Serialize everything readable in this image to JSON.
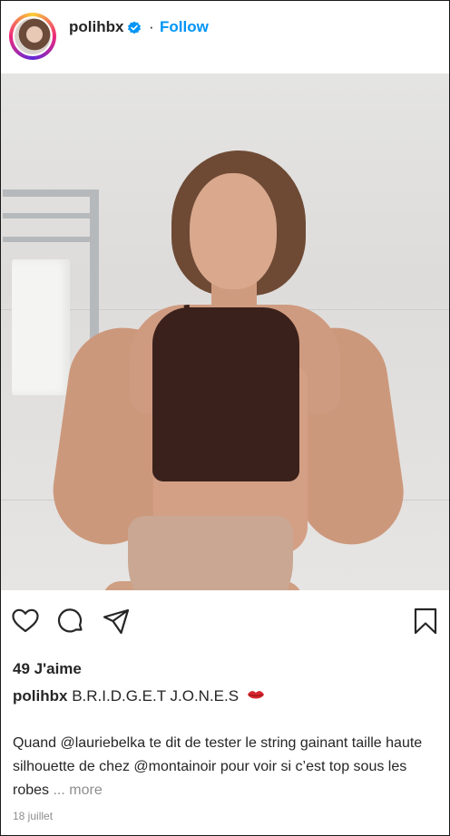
{
  "header": {
    "username": "polihbx",
    "separator": "·",
    "follow_label": "Follow",
    "verified_icon": "verified-badge-icon"
  },
  "colors": {
    "accent": "#0095f6",
    "text": "#262626",
    "muted": "#8e8e8e"
  },
  "actions": {
    "like_icon": "heart-icon",
    "comment_icon": "comment-icon",
    "share_icon": "paper-plane-icon",
    "save_icon": "bookmark-icon"
  },
  "post": {
    "likes": "49 J'aime",
    "caption_user": "polihbx",
    "caption_text": "B.R.I.D.G.E.T J.O.N.E.S",
    "caption_emoji": "lips-icon",
    "description": "Quand @lauriebelka te dit de tester le string gainant taille haute silhouette de chez @montainoir pour voir si c’est top sous les robes",
    "more_label": "... more",
    "date": "18 juillet"
  }
}
